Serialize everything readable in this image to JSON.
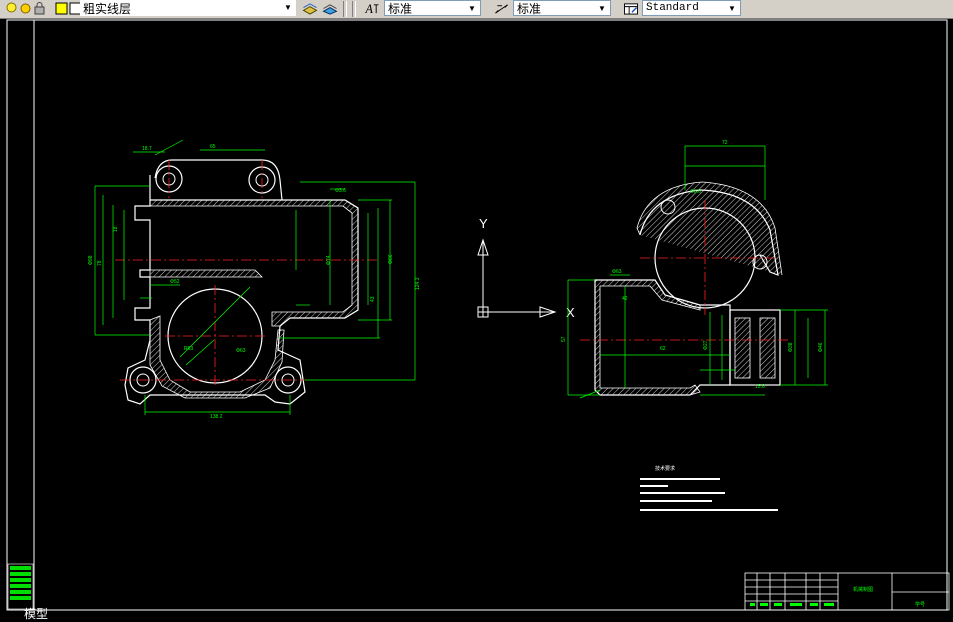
{
  "toolbar": {
    "layer_name": "粗实线层",
    "text_style": "标准",
    "dim_style": "标准",
    "table_style": "Standard"
  },
  "drawing": {
    "notes_title": "技术要求",
    "title_block_name": "机械制图",
    "title_block_unit": "学号"
  },
  "ucs": {
    "y_label": "Y",
    "x_label": "X"
  },
  "statusbar": {
    "model_tab": "模型"
  },
  "colors": {
    "background": "#000000",
    "outline": "#ffffff",
    "dimension": "#00ff00",
    "centerline": "#ff0000",
    "hatch": "#ffffff"
  }
}
